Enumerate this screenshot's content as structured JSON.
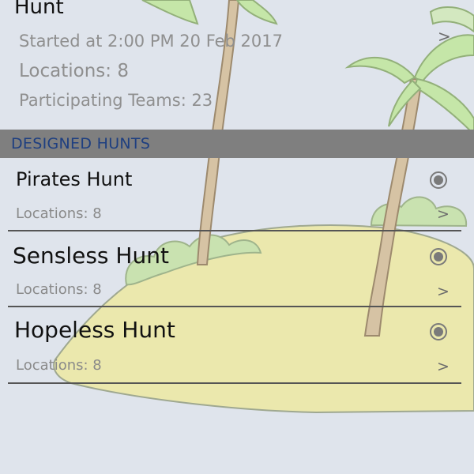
{
  "current_hunt": {
    "title": "Hunt",
    "started": "Started at 2:00 PM 20 Feb 2017",
    "locations": "Locations: 8",
    "teams": "Participating Teams: 23",
    "chevron": ">"
  },
  "section": {
    "label": "DESIGNED HUNTS"
  },
  "hunts": [
    {
      "name": "Pirates Hunt",
      "locations": "Locations: 8",
      "chevron": ">"
    },
    {
      "name": "Sensless Hunt",
      "locations": "Locations: 8",
      "chevron": ">"
    },
    {
      "name": "Hopeless Hunt",
      "locations": "Locations: 8",
      "chevron": ">"
    }
  ],
  "colors": {
    "background": "#dfe4ec",
    "section_bar": "#7f7f7f",
    "section_text": "#1e3f80",
    "island_sand": "#ebe8ad",
    "palm_leaves": "#c5e6a8"
  }
}
